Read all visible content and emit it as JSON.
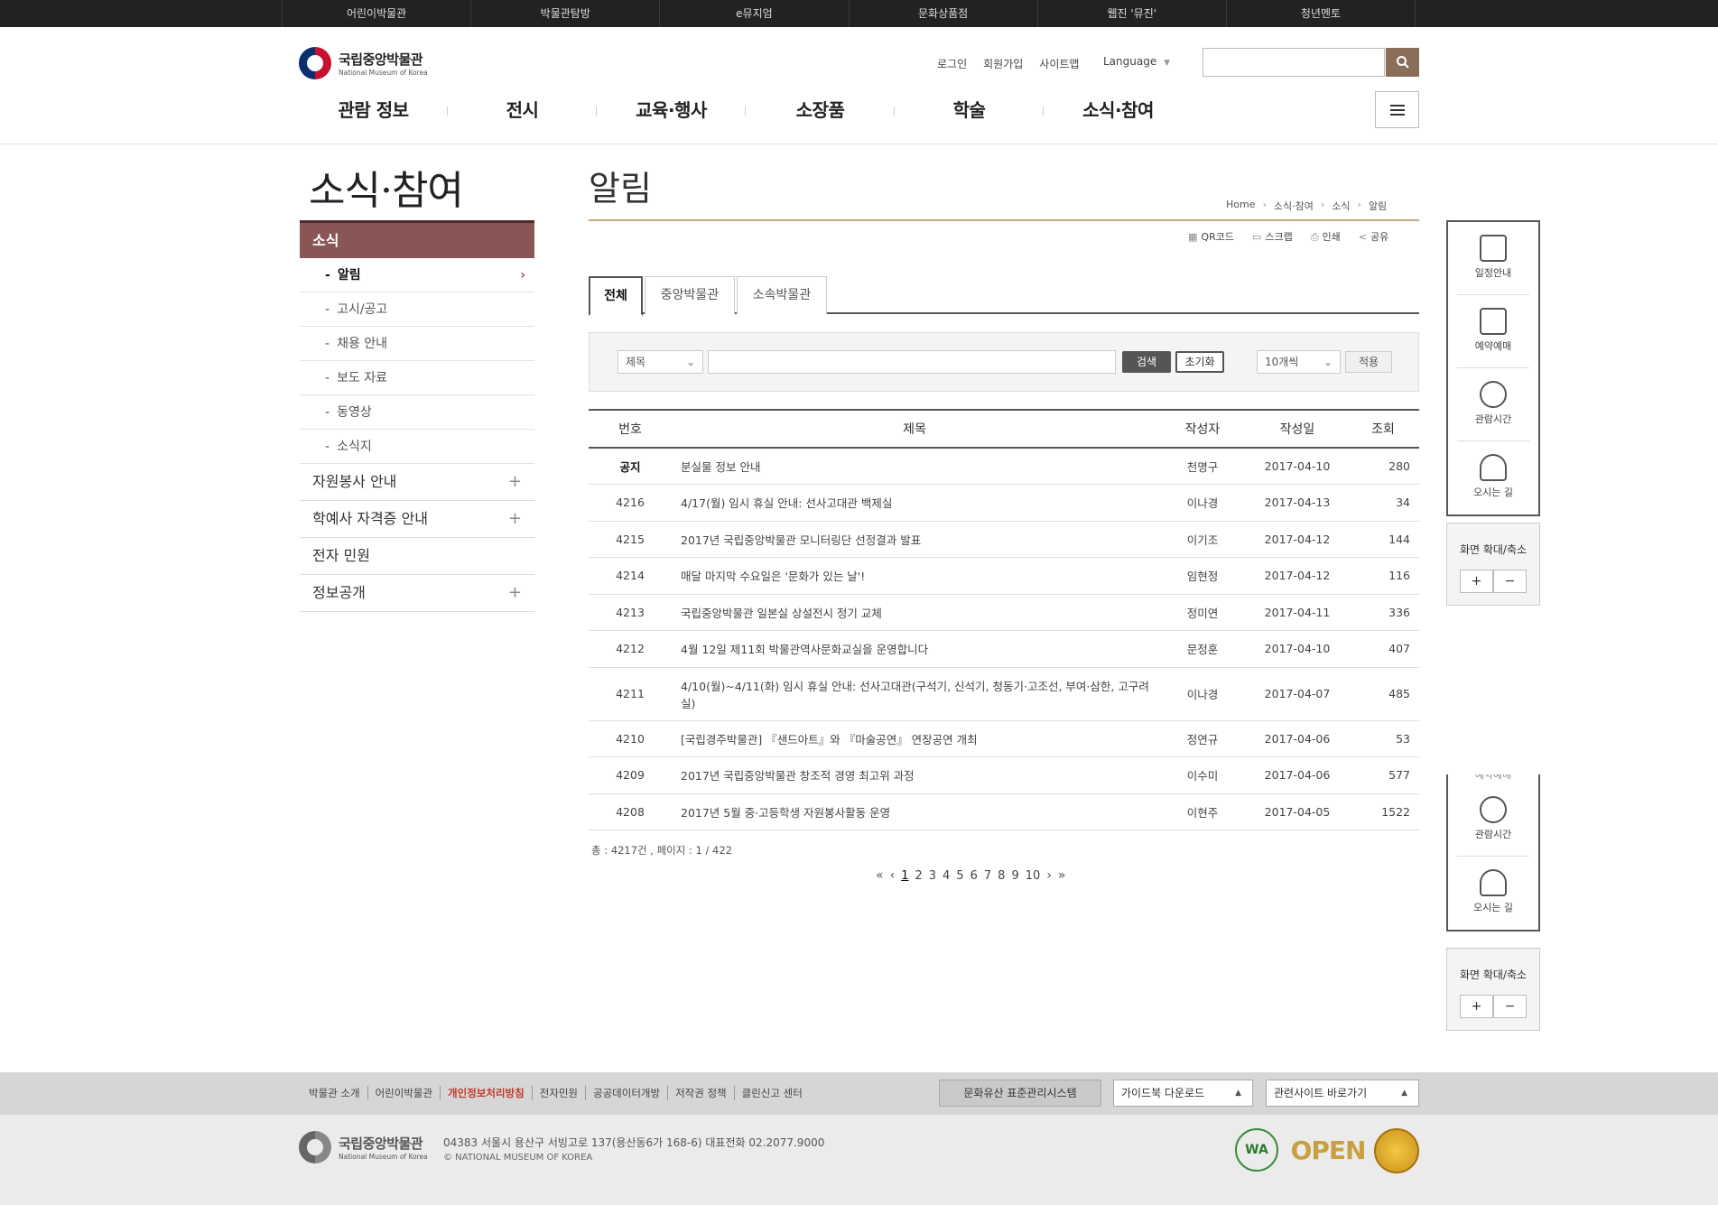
{
  "topbar": [
    "어린이박물관",
    "박물관탐방",
    "e뮤지엄",
    "문화상품점",
    "웹진 '뮤진'",
    "청년멘토"
  ],
  "logo": {
    "ko": "국립중앙박물관",
    "en": "National Museum of Korea"
  },
  "util": {
    "login": "로그인",
    "join": "회원가입",
    "sitemap": "사이트맵",
    "language": "Language"
  },
  "gnb": [
    "관람 정보",
    "전시",
    "교육·행사",
    "소장품",
    "학술",
    "소식·참여"
  ],
  "sidebar": {
    "title": "소식·참여",
    "section": "소식",
    "subitems": [
      "알림",
      "고시/공고",
      "채용 안내",
      "보도 자료",
      "동영상",
      "소식지"
    ],
    "mains": [
      "자원봉사 안내",
      "학예사 자격증 안내",
      "전자 민원",
      "정보공개"
    ]
  },
  "content": {
    "title": "알림",
    "breadcrumb": [
      "Home",
      "소식·참여",
      "소식",
      "알림"
    ],
    "tools": [
      "QR코드",
      "스크랩",
      "인쇄",
      "공유"
    ],
    "tabs": [
      "전체",
      "중앙박물관",
      "소속박물관"
    ]
  },
  "filter": {
    "field": "제목",
    "search": "검색",
    "reset": "초기화",
    "per_page": "10개씩",
    "apply": "적용"
  },
  "table": {
    "headers": [
      "번호",
      "제목",
      "작성자",
      "작성일",
      "조회"
    ],
    "rows": [
      {
        "num": "공지",
        "title": "분실물 정보 안내",
        "author": "천명구",
        "date": "2017-04-10",
        "views": "280"
      },
      {
        "num": "4216",
        "title": "4/17(월) 임시 휴실 안내: 선사고대관 백제실",
        "author": "이나경",
        "date": "2017-04-13",
        "views": "34"
      },
      {
        "num": "4215",
        "title": "2017년 국립중앙박물관 모니터링단 선정결과 발표",
        "author": "이기조",
        "date": "2017-04-12",
        "views": "144"
      },
      {
        "num": "4214",
        "title": "매달 마지막 수요일은 '문화가 있는 날'!",
        "author": "임현정",
        "date": "2017-04-12",
        "views": "116"
      },
      {
        "num": "4213",
        "title": "국립중앙박물관 일본실 상설전시 정기 교체",
        "author": "정미연",
        "date": "2017-04-11",
        "views": "336"
      },
      {
        "num": "4212",
        "title": "4월 12일 제11회 박물관역사문화교실을 운영합니다",
        "author": "문정훈",
        "date": "2017-04-10",
        "views": "407"
      },
      {
        "num": "4211",
        "title": "4/10(월)~4/11(화) 임시 휴실 안내: 선사고대관(구석기, 신석기, 청동기·고조선, 부여·삼한, 고구려실)",
        "author": "이나경",
        "date": "2017-04-07",
        "views": "485"
      },
      {
        "num": "4210",
        "title": "[국립경주박물관] 『샌드아트』와 『마술공연』 연장공연 개최",
        "author": "정연규",
        "date": "2017-04-06",
        "views": "53"
      },
      {
        "num": "4209",
        "title": "2017년 국립중앙박물관 창조적 경영 최고위 과정",
        "author": "이수미",
        "date": "2017-04-06",
        "views": "577"
      },
      {
        "num": "4208",
        "title": "2017년 5월 중·고등학생 자원봉사활동 운영",
        "author": "이현주",
        "date": "2017-04-05",
        "views": "1522"
      }
    ]
  },
  "summary": "총 : 4217건 , 페이지 : 1 / 422",
  "pager": {
    "first": "«",
    "prev": "‹",
    "pages": [
      "1",
      "2",
      "3",
      "4",
      "5",
      "6",
      "7",
      "8",
      "9",
      "10"
    ],
    "next": "›",
    "last": "»"
  },
  "quick": {
    "items": [
      "일정안내",
      "예약예매",
      "관람시간",
      "오시는 길"
    ],
    "zoom": "화면 확대/축소",
    "plus": "+",
    "minus": "−"
  },
  "quick_dup": {
    "partial": "예약예매",
    "items": [
      "관람시간",
      "오시는 길"
    ],
    "zoom": "화면 확대/축소",
    "plus": "+",
    "minus": "−"
  },
  "footer": {
    "links": [
      "박물관 소개",
      "어린이박물관",
      "개인정보처리방침",
      "전자민원",
      "공공데이터개방",
      "저작권 정책",
      "클린신고 센터"
    ],
    "std_btn": "문화유산 표준관리시스템",
    "guide": "가이드북 다운로드",
    "related": "관련사이트 바로가기",
    "address": "04383 서울시 용산구 서빙고로 137(용산동6가 168-6)    대표전화 02.2077.9000",
    "copyright": "© NATIONAL MUSEUM OF KOREA",
    "badges": [
      "WA",
      "OPEN"
    ]
  },
  "colors": {
    "accent": "#8a5555",
    "brand": "#8a6e5a",
    "gold": "#c8a97a"
  }
}
